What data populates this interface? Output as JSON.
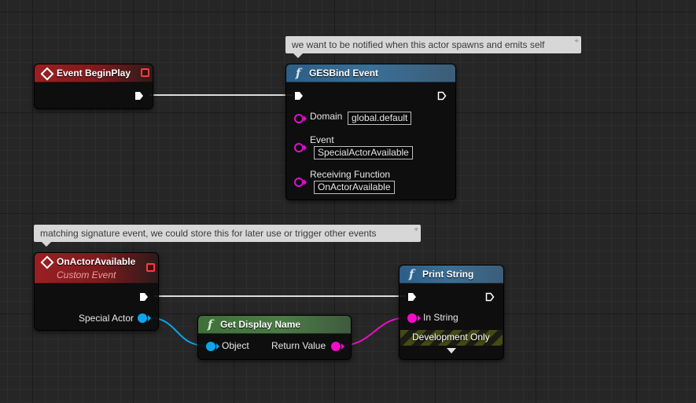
{
  "graph": {
    "background": "#262626",
    "wire_colors": {
      "exec": "#e6e6e6",
      "object": "#0aa6ee",
      "string": "#f40cc8"
    }
  },
  "comments": [
    {
      "text": "we want to be notified when this actor spawns and emits self"
    },
    {
      "text": "matching signature event, we could store this for later use or trigger other events"
    }
  ],
  "nodes": {
    "event_beginplay": {
      "title": "Event BeginPlay",
      "icon": "event-diamond-icon"
    },
    "gesbind_event": {
      "title": "GESBind Event",
      "icon": "function-icon",
      "pins": [
        {
          "label": "Domain",
          "value": "global.default"
        },
        {
          "label": "Event",
          "value": "SpecialActorAvailable"
        },
        {
          "label": "Receiving Function",
          "value": "OnActorAvailable"
        }
      ]
    },
    "on_actor_available": {
      "title": "OnActorAvailable",
      "subtitle": "Custom Event",
      "icon": "event-diamond-icon",
      "output_pin": "Special Actor"
    },
    "get_display_name": {
      "title": "Get Display Name",
      "icon": "function-icon",
      "input_pin": "Object",
      "output_pin": "Return Value"
    },
    "print_string": {
      "title": "Print String",
      "icon": "function-icon",
      "input_pin": "In String",
      "footer": "Development Only"
    }
  }
}
